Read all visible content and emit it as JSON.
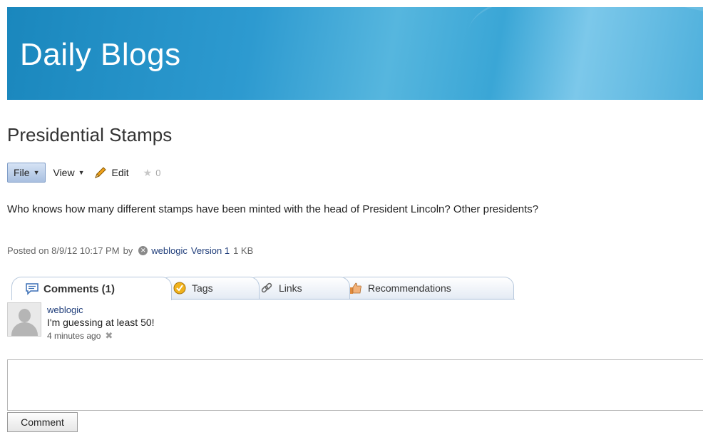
{
  "header": {
    "title": "Daily Blogs"
  },
  "post": {
    "title": "Presidential Stamps",
    "toolbar": {
      "file_label": "File",
      "view_label": "View",
      "edit_label": "Edit",
      "rating_count": "0"
    },
    "body": "Who knows how many different stamps have been minted with the head of President Lincoln?  Other presidents?",
    "meta": {
      "posted": "Posted on 8/9/12 10:17 PM",
      "by": "by",
      "author": "weblogic",
      "version": "Version 1",
      "size": "1 KB"
    }
  },
  "tabs": [
    {
      "label": "Comments (1)",
      "icon": "comment-icon",
      "active": true
    },
    {
      "label": "Tags",
      "icon": "tag-icon",
      "active": false
    },
    {
      "label": "Links",
      "icon": "link-icon",
      "active": false
    },
    {
      "label": "Recommendations",
      "icon": "thumbs-up-icon",
      "active": false
    }
  ],
  "comments": [
    {
      "author": "weblogic",
      "text": "I'm guessing at least 50!",
      "time": "4 minutes ago"
    }
  ],
  "comment_form": {
    "button_label": "Comment"
  },
  "colors": {
    "banner": "#2d9ad0",
    "link": "#1f3d7a",
    "active_button": "#a9c0e0"
  }
}
